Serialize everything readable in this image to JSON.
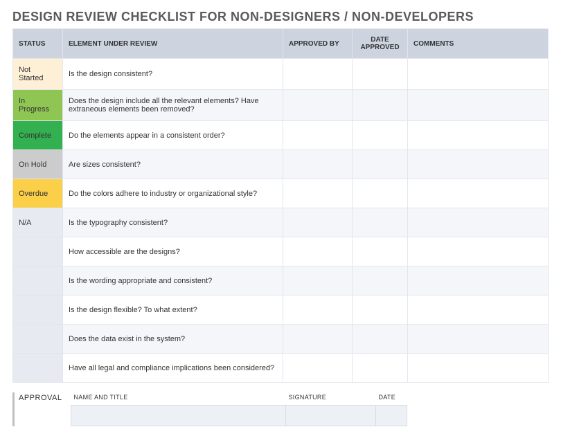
{
  "title": "DESIGN REVIEW CHECKLIST FOR NON-DESIGNERS / NON-DEVELOPERS",
  "columns": {
    "status": "STATUS",
    "element": "ELEMENT UNDER REVIEW",
    "approved_by": "APPROVED BY",
    "date_approved": "DATE APPROVED",
    "comments": "COMMENTS"
  },
  "rows": [
    {
      "status": "Not Started",
      "status_class": "status-notstarted",
      "element": "Is the design consistent?",
      "approved_by": "",
      "date_approved": "",
      "comments": ""
    },
    {
      "status": "In Progress",
      "status_class": "status-inprogress",
      "element": "Does the design include all the relevant elements? Have extraneous elements been removed?",
      "approved_by": "",
      "date_approved": "",
      "comments": ""
    },
    {
      "status": "Complete",
      "status_class": "status-complete",
      "element": "Do the elements appear in a consistent order?",
      "approved_by": "",
      "date_approved": "",
      "comments": ""
    },
    {
      "status": "On Hold",
      "status_class": "status-onhold",
      "element": "Are sizes consistent?",
      "approved_by": "",
      "date_approved": "",
      "comments": ""
    },
    {
      "status": "Overdue",
      "status_class": "status-overdue",
      "element": "Do the colors adhere to industry or organizational style?",
      "approved_by": "",
      "date_approved": "",
      "comments": ""
    },
    {
      "status": "N/A",
      "status_class": "status-na",
      "element": "Is the typography consistent?",
      "approved_by": "",
      "date_approved": "",
      "comments": ""
    },
    {
      "status": "",
      "status_class": "",
      "element": "How accessible are the designs?",
      "approved_by": "",
      "date_approved": "",
      "comments": ""
    },
    {
      "status": "",
      "status_class": "",
      "element": "Is the wording appropriate and consistent?",
      "approved_by": "",
      "date_approved": "",
      "comments": ""
    },
    {
      "status": "",
      "status_class": "",
      "element": "Is the design flexible? To what extent?",
      "approved_by": "",
      "date_approved": "",
      "comments": ""
    },
    {
      "status": "",
      "status_class": "",
      "element": "Does the data exist in the system?",
      "approved_by": "",
      "date_approved": "",
      "comments": ""
    },
    {
      "status": "",
      "status_class": "",
      "element": "Have all legal and compliance implications been considered?",
      "approved_by": "",
      "date_approved": "",
      "comments": ""
    }
  ],
  "approval": {
    "label": "APPROVAL",
    "headers": {
      "name": "NAME AND TITLE",
      "signature": "SIGNATURE",
      "date": "DATE"
    },
    "values": {
      "name": "",
      "signature": "",
      "date": ""
    }
  }
}
